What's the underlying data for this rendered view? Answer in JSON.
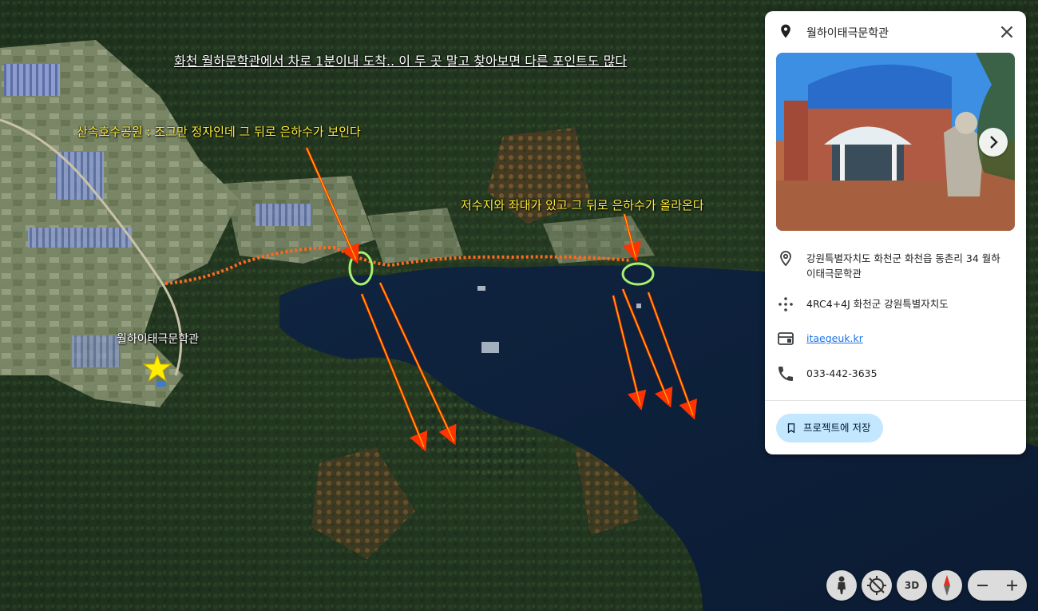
{
  "annotations": {
    "headline": "화천 월하문학관에서 차로 1분이내 도착.. 이 두 곳 말고 찾아보면 다른 포인트도 많다",
    "point1": "산속호수공원 : 조그만 정자인데 그 뒤로 은하수가 보인다",
    "point2": "저수지와 좌대가 있고 그 뒤로 은하수가 올라온다"
  },
  "map": {
    "place_label": "월하이태극문학관",
    "colors": {
      "route": "#ff5a1f",
      "circle": "#a8f070",
      "arrow": "#ff2a00",
      "star": "#ffee00"
    }
  },
  "panel": {
    "title": "월하이태극문학관",
    "address": "강원특별자치도 화천군 화천읍 동촌리 34 월하이태극문학관",
    "plus_code": "4RC4+4J 화천군 강원특별자치도",
    "website": "itaegeuk.kr",
    "phone": "033-442-3635",
    "save_label": "프로젝트에 저장",
    "icons": [
      "place-pin-icon",
      "close-icon",
      "chevron-right-icon",
      "location-pin-icon",
      "plus-code-icon",
      "website-icon",
      "phone-icon",
      "bookmark-icon"
    ]
  },
  "controls": {
    "three_d_label": "3D",
    "icons": [
      "pegman-icon",
      "rotate-icon",
      "compass-icon",
      "zoom-out-icon",
      "zoom-in-icon"
    ]
  }
}
